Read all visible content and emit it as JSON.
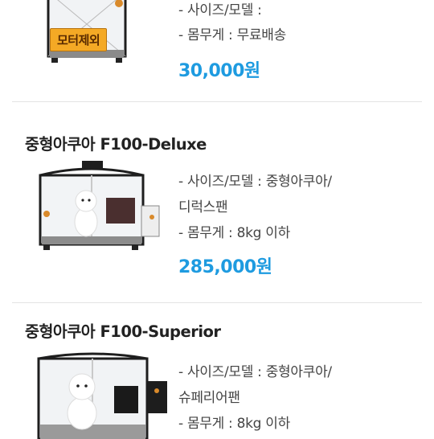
{
  "products": [
    {
      "title": "",
      "size_label": "- 사이즈/모델 :",
      "size_value": "",
      "size_value_line2": "",
      "weight_label": "- 몸무게 :",
      "weight_value": "무료배송",
      "price": "30,000원",
      "badge": "모터제외"
    },
    {
      "title": "중형아쿠아 F100-Deluxe",
      "size_label": "- 사이즈/모델 :",
      "size_value": "중형아쿠아/",
      "size_value_line2": "디럭스팬",
      "weight_label": "- 몸무게 :",
      "weight_value": "8kg 이하",
      "price": "285,000원"
    },
    {
      "title": "중형아쿠아 F100-Superior",
      "size_label": "- 사이즈/모델 :",
      "size_value": "중형아쿠아/",
      "size_value_line2": "슈페리어팬",
      "weight_label": "- 몸무게 :",
      "weight_value": "8kg 이하",
      "price": ""
    }
  ],
  "colors": {
    "price": "#1e9be0",
    "badge_bg": "#f4a925",
    "divider": "#e3e3e3"
  }
}
